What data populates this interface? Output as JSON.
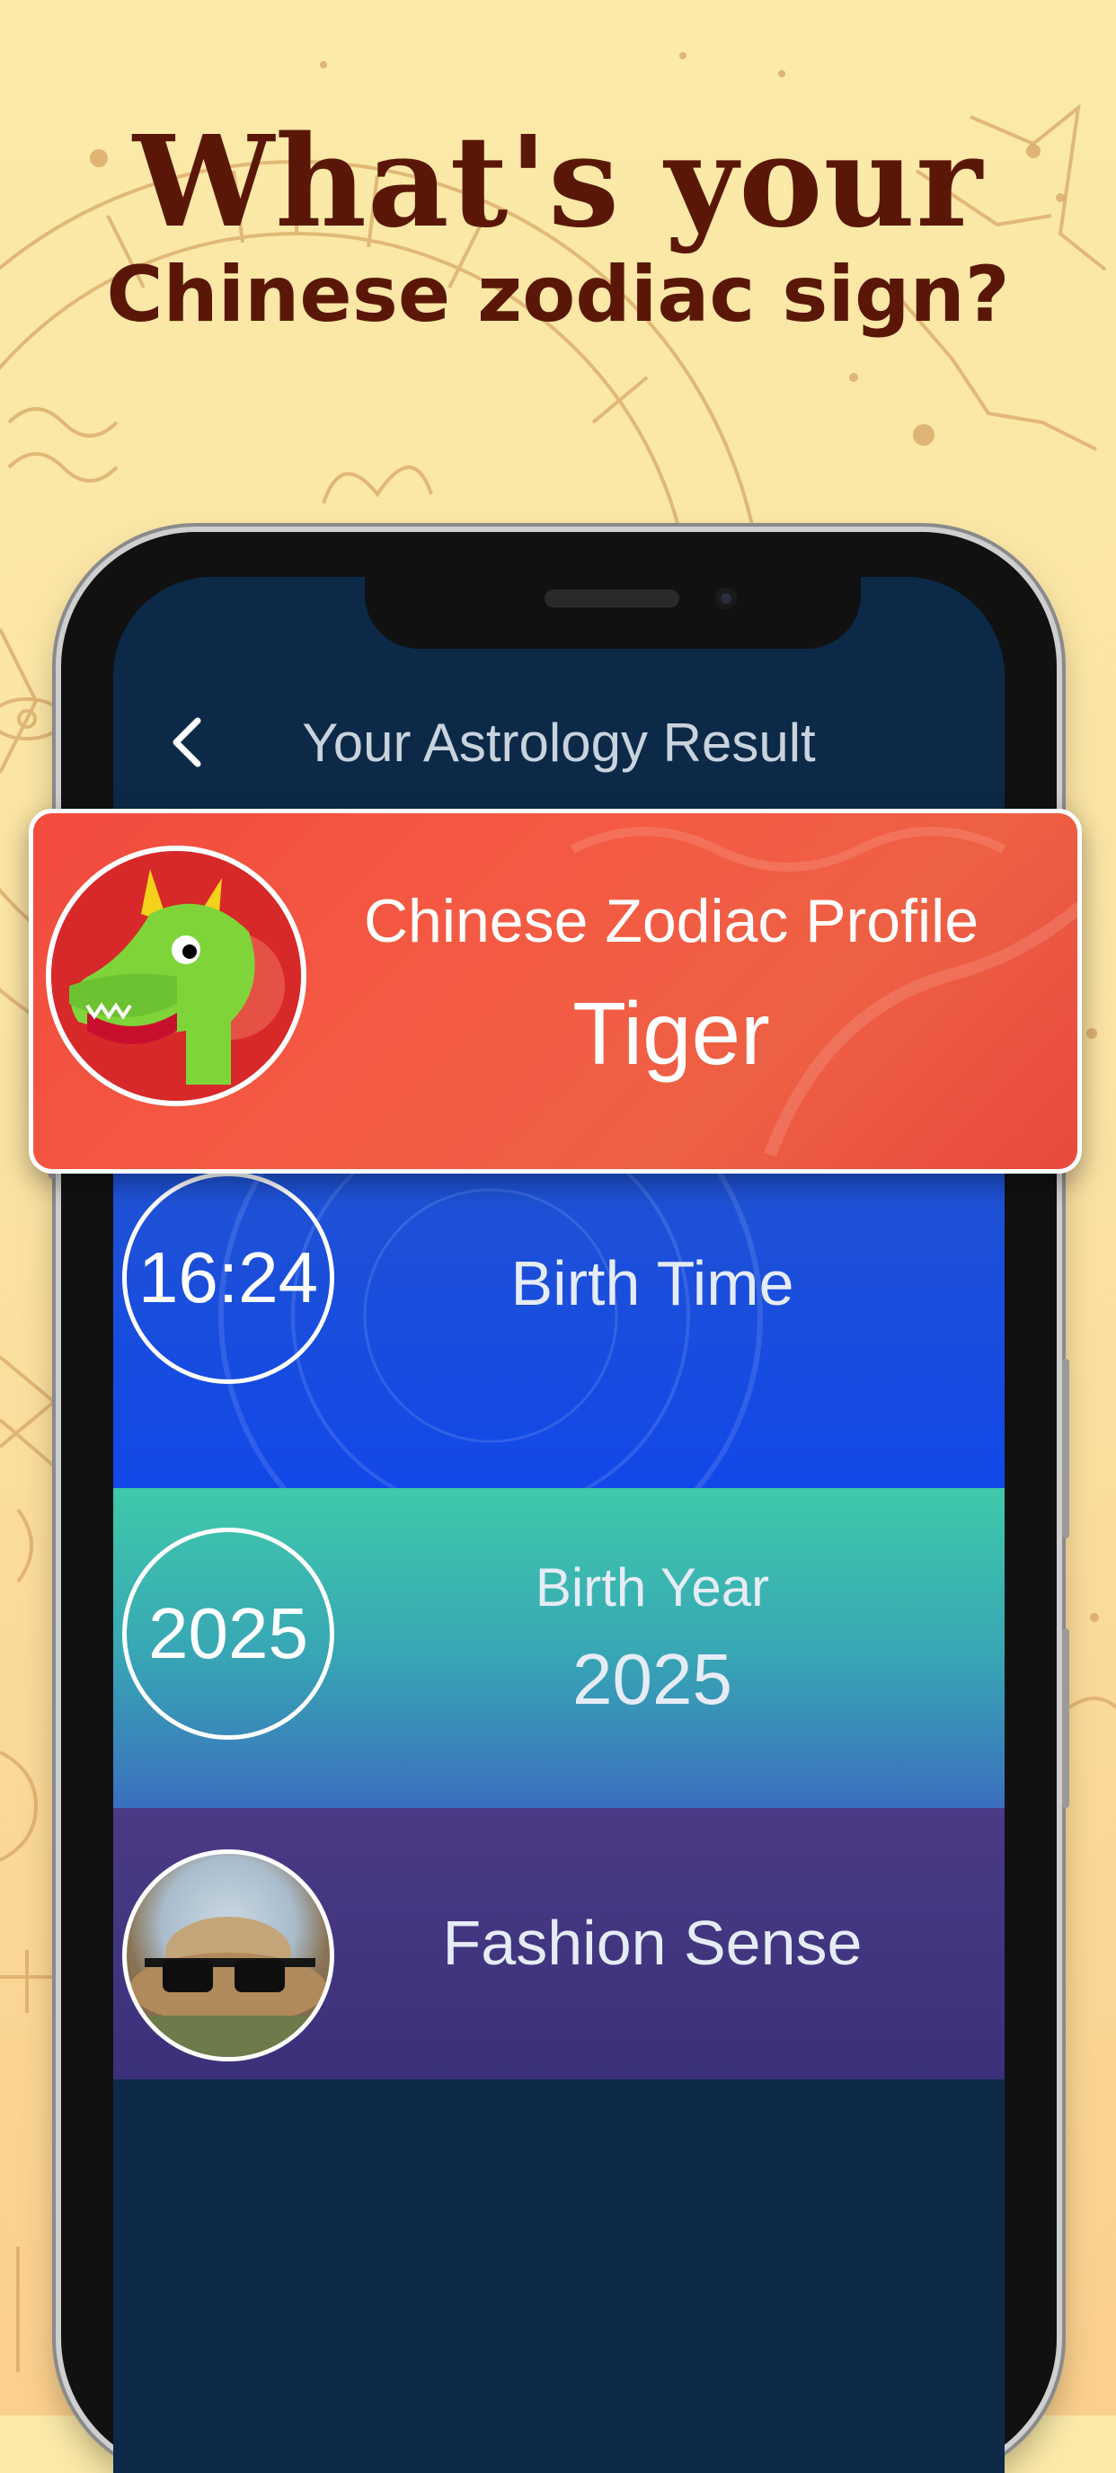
{
  "headline": {
    "line1": "What's your",
    "line2": "Chinese zodiac sign?"
  },
  "icons": {
    "back": "chevron-left-icon",
    "dragon": "dragon-icon",
    "fashion": "sunglasses-hat-photo"
  },
  "colors": {
    "background": "#fbe3a3",
    "headline": "#5a1707",
    "screen": "#0c2a48",
    "card": "#f24b3e",
    "birth_time_row": "#1248e8",
    "birth_year_row": "#3fc9aa",
    "fashion_row": "#3a317a"
  },
  "app": {
    "nav": {
      "back_label": "<",
      "title": "Your Astrology Result"
    },
    "profile_card": {
      "title": "Chinese Zodiac Profile",
      "value": "Tiger"
    },
    "rows": [
      {
        "circle_text": "16:24",
        "label": "Birth Time"
      },
      {
        "circle_text": "2025",
        "label": "Birth Year",
        "value": "2025"
      },
      {
        "label": "Fashion Sense"
      }
    ]
  }
}
